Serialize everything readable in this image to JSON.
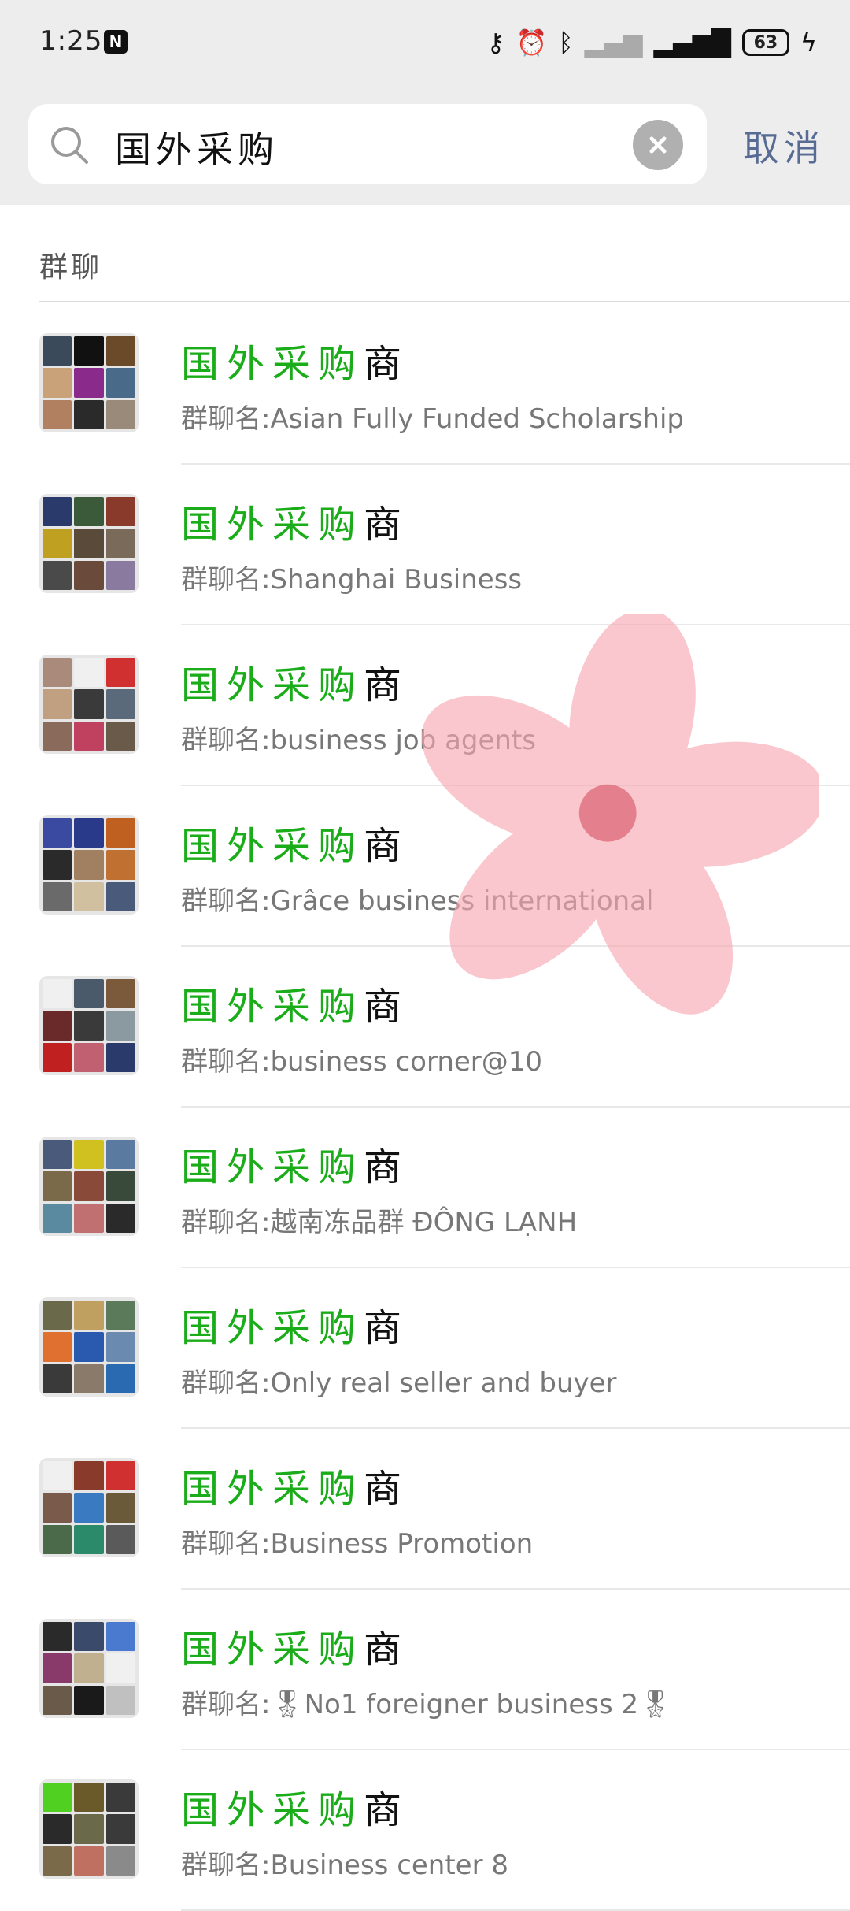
{
  "status_bar": {
    "time": "1:25",
    "notification_icon": "n-app-icon",
    "icons": [
      "key-icon",
      "alarm-icon",
      "bluetooth-icon",
      "signal-x-icon",
      "signal-4g-icon"
    ],
    "battery": "63",
    "charging_icon": "lightning-icon"
  },
  "search": {
    "query": "国外采购",
    "search_icon": "search-icon",
    "clear_icon": "clear-icon",
    "cancel_label": "取消"
  },
  "section": {
    "title": "群聊"
  },
  "results": [
    {
      "title_highlight": "国外采购",
      "title_rest": "商",
      "subtitle": "群聊名:Asian Fully Funded Scholarship"
    },
    {
      "title_highlight": "国外采购",
      "title_rest": "商",
      "subtitle": "群聊名:Shanghai Business"
    },
    {
      "title_highlight": "国外采购",
      "title_rest": "商",
      "subtitle": "群聊名:business job agents"
    },
    {
      "title_highlight": "国外采购",
      "title_rest": "商",
      "subtitle": "群聊名:Grâce business international"
    },
    {
      "title_highlight": "国外采购",
      "title_rest": "商",
      "subtitle": "群聊名:business corner@10"
    },
    {
      "title_highlight": "国外采购",
      "title_rest": "商",
      "subtitle": "群聊名:越南冻品群 ĐÔNG LẠNH"
    },
    {
      "title_highlight": "国外采购",
      "title_rest": "商",
      "subtitle": "群聊名:Only real seller and buyer"
    },
    {
      "title_highlight": "国外采购",
      "title_rest": "商",
      "subtitle": "群聊名:Business Promotion"
    },
    {
      "title_highlight": "国外采购",
      "title_rest": "商",
      "subtitle": "群聊名:🎖No1 foreigner business 2🎖"
    },
    {
      "title_highlight": "国外采购",
      "title_rest": "商",
      "subtitle": "群聊名:Business center 8"
    }
  ],
  "colors": {
    "highlight": "#1aad19",
    "link": "#576b95",
    "background_header": "#ededed"
  }
}
